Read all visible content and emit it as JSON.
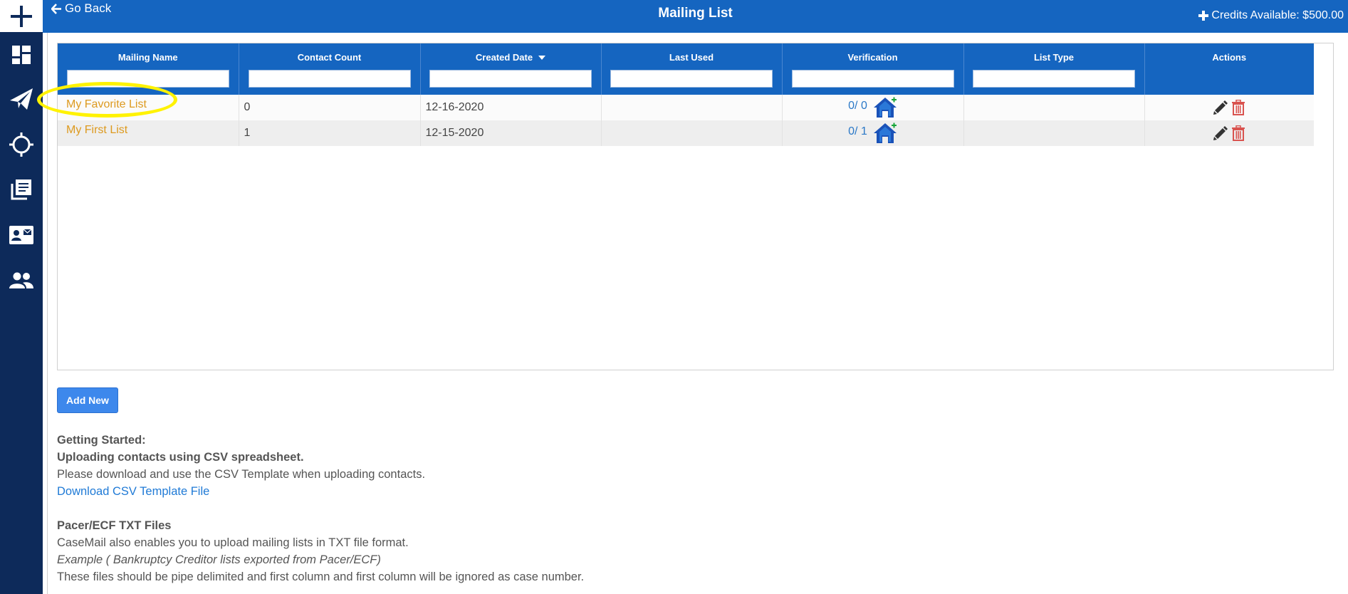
{
  "sidebar": {
    "items": [
      {
        "icon": "plus-icon"
      },
      {
        "icon": "dashboard-icon"
      },
      {
        "icon": "send-icon"
      },
      {
        "icon": "crosshair-icon"
      },
      {
        "icon": "library-icon"
      },
      {
        "icon": "contact-card-icon"
      },
      {
        "icon": "people-icon"
      }
    ]
  },
  "header": {
    "back_label": "Go Back",
    "title": "Mailing List",
    "credits_label": "Credits Available: $500.00"
  },
  "table": {
    "columns": [
      "Mailing Name",
      "Contact Count",
      "Created Date",
      "Last Used",
      "Verification",
      "List Type",
      "Actions"
    ],
    "sorted_column": "Created Date",
    "sort_direction": "descending",
    "rows": [
      {
        "name": "My Favorite List",
        "contact_count": "0",
        "created_date": "12-16-2020",
        "last_used": "",
        "verification": "0/ 0",
        "list_type": ""
      },
      {
        "name": "My First List",
        "contact_count": "1",
        "created_date": "12-15-2020",
        "last_used": "",
        "verification": "0/ 1",
        "list_type": ""
      }
    ]
  },
  "add_button_label": "Add New",
  "info": {
    "getting_started": "Getting Started:",
    "csv_heading": "Uploading contacts using CSV spreadsheet.",
    "csv_text": "Please download and use the CSV Template when uploading contacts.",
    "csv_link": "Download CSV Template File",
    "txt_heading": "Pacer/ECF TXT Files",
    "txt_text": "CaseMail also enables you to upload mailing lists in TXT file format.",
    "txt_example": "Example ( Bankruptcy Creditor lists exported from Pacer/ECF)",
    "txt_note": "These files should be pipe delimited and first column and first column will be ignored as case number."
  },
  "colors": {
    "sidebar": "#0d2a5a",
    "header": "#1565c0",
    "link_orange": "#dd9a1f",
    "link_blue": "#1f7ad6",
    "highlight": "#fff200",
    "delete_red": "#d9534f"
  }
}
